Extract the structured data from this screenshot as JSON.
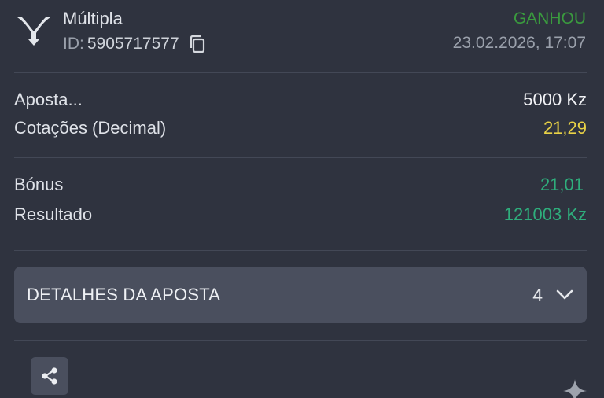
{
  "header": {
    "icon": "multiple-bet-icon",
    "bet_type": "Múltipla",
    "id_label": "ID:",
    "id_value": "5905717577",
    "status": "GANHOU",
    "datetime": "23.02.2026, 17:07"
  },
  "summary": {
    "stake_label": "Aposta...",
    "stake_value": "5000 Kz",
    "odds_label": "Cotações (Decimal)",
    "odds_value": "21,29",
    "bonus_label": "Bónus",
    "bonus_value": "21,01",
    "result_label": "Resultado",
    "result_value": "121003 Kz"
  },
  "details": {
    "label": "DETALHES DA APOSTA",
    "count": "4"
  },
  "colors": {
    "background": "#2f333f",
    "won": "#3a9a3e",
    "odds": "#e9d246",
    "positive": "#2fae7c"
  }
}
